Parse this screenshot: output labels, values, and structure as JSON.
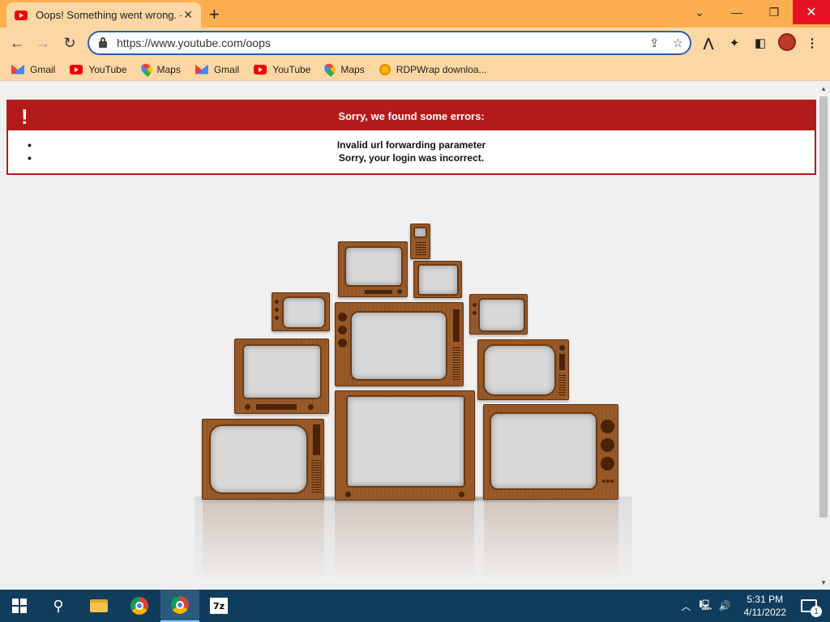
{
  "browser": {
    "tab_title": "Oops! Something went wrong. -",
    "url": "https://www.youtube.com/oops",
    "bookmarks": [
      {
        "label": "Gmail",
        "icon": "gmail-icon"
      },
      {
        "label": "YouTube",
        "icon": "youtube-icon"
      },
      {
        "label": "Maps",
        "icon": "maps-icon"
      },
      {
        "label": "Gmail",
        "icon": "gmail-icon"
      },
      {
        "label": "YouTube",
        "icon": "youtube-icon"
      },
      {
        "label": "Maps",
        "icon": "maps-icon"
      },
      {
        "label": "RDPWrap downloa...",
        "icon": "rdpwrap-icon"
      }
    ],
    "frame_color": "#fdaf50",
    "toolbar_color": "#fdd7a3"
  },
  "error": {
    "icon": "!",
    "heading": "Sorry, we found some errors:",
    "items": [
      "Invalid url forwarding parameter",
      "Sorry, your login was incorrect."
    ],
    "accent_color": "#b31b1b"
  },
  "taskbar": {
    "time": "5:31 PM",
    "date": "4/11/2022",
    "notification_count": "1",
    "apps": [
      "start-button",
      "search-button",
      "file-explorer",
      "chrome",
      "chrome-active",
      "7zip"
    ]
  }
}
